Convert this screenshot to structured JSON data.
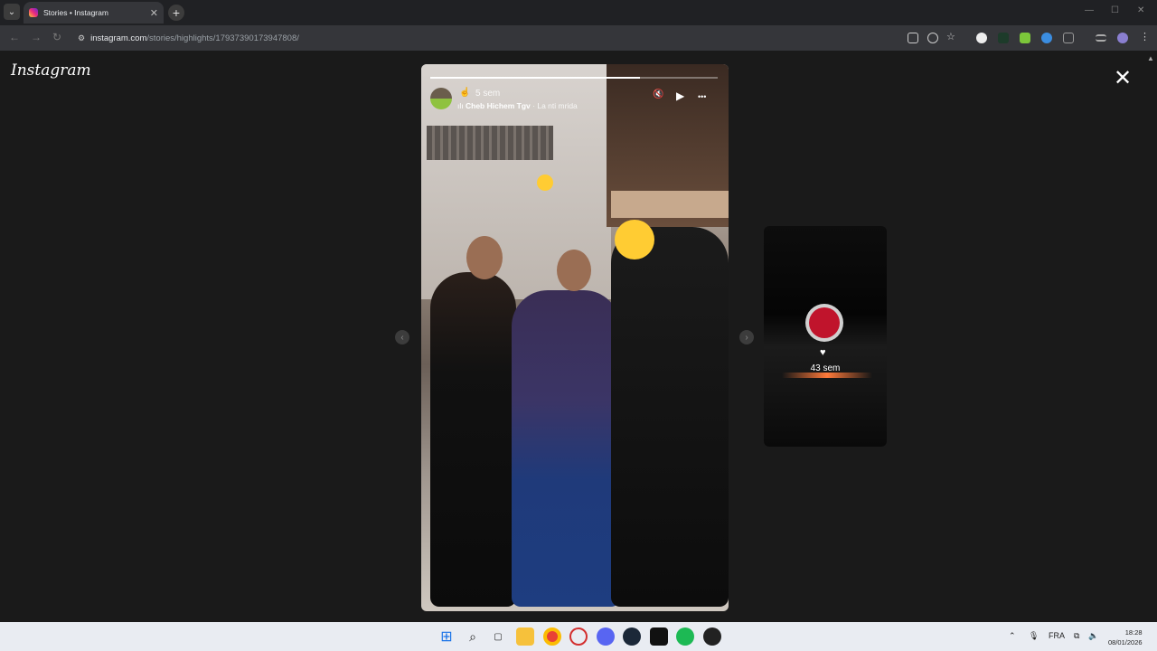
{
  "browser": {
    "tab_title": "Stories • Instagram",
    "tab_close": "✕",
    "new_tab": "+",
    "url_host": "instagram.com",
    "url_path": "/stories/highlights/17937390173947808/"
  },
  "page": {
    "logo": "Instagram",
    "close": "✕"
  },
  "story": {
    "progress_fraction": 0.73,
    "time": "5 sem",
    "music_icon": "ılı",
    "artist": "Cheb Hichem Tgv",
    "song_sep": " · ",
    "song": "La nti mrida",
    "mute_icon": "🔇",
    "play_icon": "▶",
    "more_icon": "•••"
  },
  "nav": {
    "prev": "‹",
    "next": "›"
  },
  "next_story": {
    "heart": "♥",
    "age": "43 sem"
  },
  "taskbar": {
    "tray_lang": "FRA",
    "time": "18:28",
    "date": "08/01/2026"
  }
}
